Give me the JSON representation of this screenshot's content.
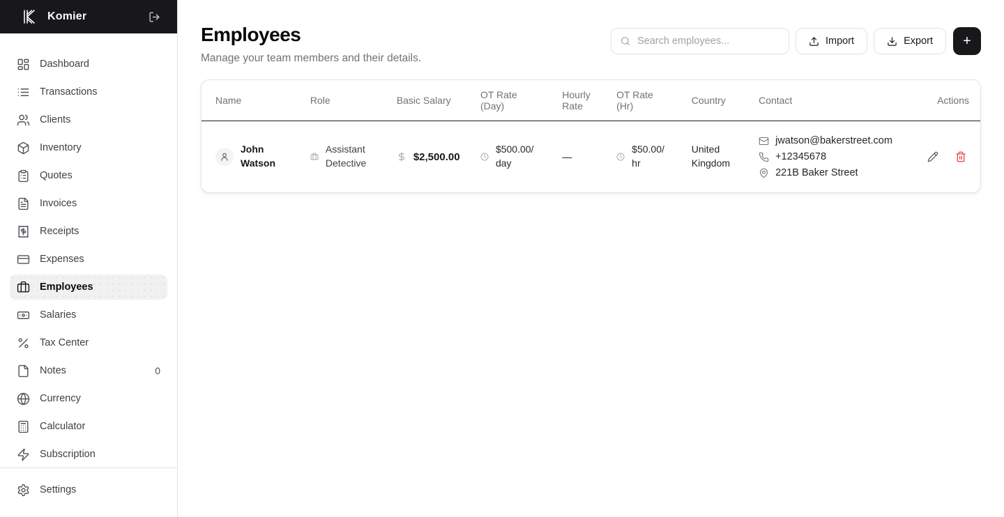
{
  "brand": {
    "name": "Komier"
  },
  "sidebar": {
    "items": [
      {
        "label": "Dashboard",
        "icon": "dashboard-grid-icon",
        "active": false
      },
      {
        "label": "Transactions",
        "icon": "list-icon",
        "active": false
      },
      {
        "label": "Clients",
        "icon": "users-icon",
        "active": false
      },
      {
        "label": "Inventory",
        "icon": "package-icon",
        "active": false
      },
      {
        "label": "Quotes",
        "icon": "clipboard-list-icon",
        "active": false
      },
      {
        "label": "Invoices",
        "icon": "file-text-icon",
        "active": false
      },
      {
        "label": "Receipts",
        "icon": "receipt-icon",
        "active": false
      },
      {
        "label": "Expenses",
        "icon": "credit-card-icon",
        "active": false
      },
      {
        "label": "Employees",
        "icon": "briefcase-icon",
        "active": true
      },
      {
        "label": "Salaries",
        "icon": "banknote-icon",
        "active": false
      },
      {
        "label": "Tax Center",
        "icon": "percent-icon",
        "active": false
      },
      {
        "label": "Notes",
        "icon": "file-icon",
        "badge": "0",
        "active": false
      },
      {
        "label": "Currency",
        "icon": "globe-icon",
        "active": false
      },
      {
        "label": "Calculator",
        "icon": "calculator-icon",
        "active": false
      },
      {
        "label": "Subscription",
        "icon": "zap-icon",
        "active": false
      }
    ],
    "footer": {
      "settings_label": "Settings"
    }
  },
  "page": {
    "title": "Employees",
    "subtitle": "Manage your team members and their details.",
    "search_placeholder": "Search employees...",
    "import_label": "Import",
    "export_label": "Export",
    "add_label": "+"
  },
  "table": {
    "columns": [
      "Name",
      "Role",
      "Basic Salary",
      "OT Rate (Day)",
      "Hourly Rate",
      "OT Rate (Hr)",
      "Country",
      "Contact",
      "Actions"
    ],
    "rows": [
      {
        "name": "John Watson",
        "role": "Assistant Detective",
        "basic_salary": "$2,500.00",
        "ot_rate_day": "$500.00/ day",
        "hourly_rate": "—",
        "ot_rate_hr": "$50.00/ hr",
        "country": "United Kingdom",
        "contact": {
          "email": "jwatson@bakerstreet.com",
          "phone": "+12345678",
          "address": "221B Baker Street"
        }
      }
    ]
  },
  "colors": {
    "topbar_bg": "#18181b",
    "accent_dark": "#18181b",
    "danger_red": "#ef4444",
    "muted_text": "#71717a",
    "border": "#e4e4e7",
    "active_item_bg": "#f1f1f2"
  }
}
